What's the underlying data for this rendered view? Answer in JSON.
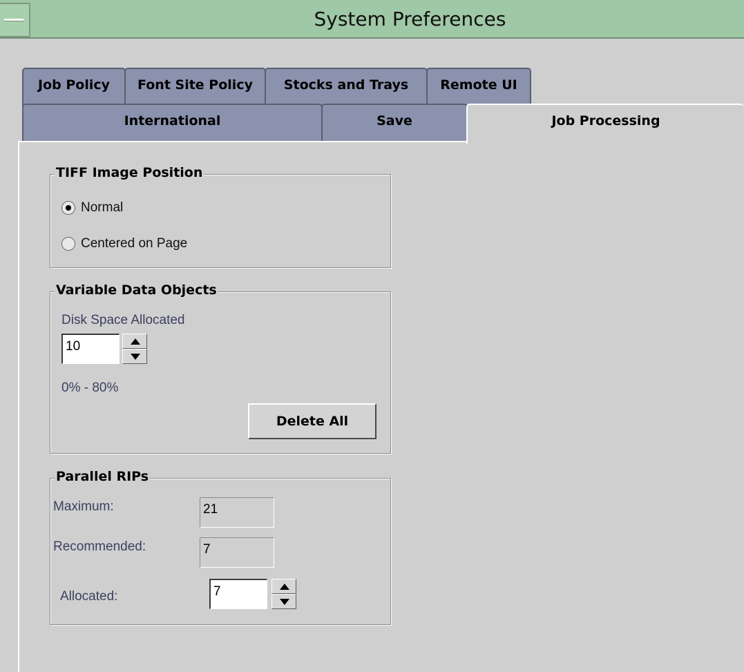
{
  "window": {
    "title": "System Preferences",
    "menu_icon": "window-menu-icon"
  },
  "tabs": {
    "row1": [
      {
        "label": "Job Policy"
      },
      {
        "label": "Font Site Policy"
      },
      {
        "label": "Stocks and Trays"
      },
      {
        "label": "Remote UI"
      }
    ],
    "row2": [
      {
        "label": "International"
      },
      {
        "label": "Save"
      },
      {
        "label": "Job Processing",
        "selected": true
      }
    ]
  },
  "tiff_image_position": {
    "legend": "TIFF Image Position",
    "options": [
      {
        "label": "Normal",
        "selected": true
      },
      {
        "label": "Centered on Page",
        "selected": false
      }
    ]
  },
  "variable_data_objects": {
    "legend": "Variable Data Objects",
    "disk_space_label": "Disk Space Allocated",
    "disk_space_value": "10",
    "range_label": "0% - 80%",
    "delete_all_label": "Delete All"
  },
  "parallel_rips": {
    "legend": "Parallel RIPs",
    "maximum_label": "Maximum:",
    "maximum_value": "21",
    "recommended_label": "Recommended:",
    "recommended_value": "7",
    "allocated_label": "Allocated:",
    "allocated_value": "7"
  },
  "colors": {
    "titlebar": "#9fc8a6",
    "tab": "#8a92ad",
    "background": "#cfcfcf"
  }
}
